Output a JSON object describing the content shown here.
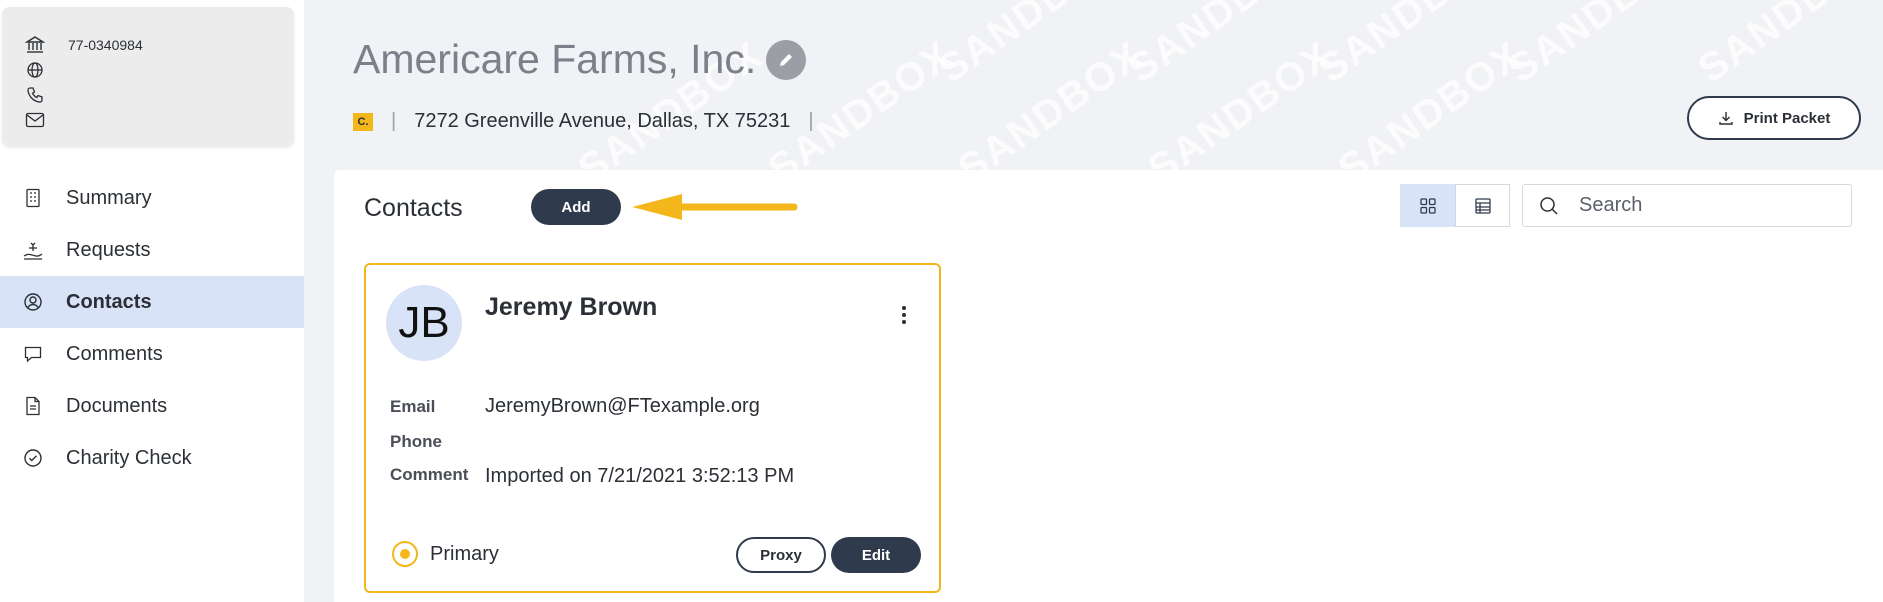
{
  "org": {
    "ein": "77-0340984",
    "name": "Americare Farms, Inc.",
    "badge": "C.",
    "address": "7272 Greenville Avenue, Dallas, TX 75231",
    "separator": "|"
  },
  "sidebar": {
    "items": [
      {
        "label": "Summary",
        "icon": "building-icon"
      },
      {
        "label": "Requests",
        "icon": "hand-gift-icon"
      },
      {
        "label": "Contacts",
        "icon": "user-circle-icon",
        "active": true
      },
      {
        "label": "Comments",
        "icon": "chat-bubble-icon"
      },
      {
        "label": "Documents",
        "icon": "document-icon"
      },
      {
        "label": "Charity Check",
        "icon": "check-circle-icon"
      }
    ]
  },
  "header": {
    "print_label": "Print Packet",
    "watermark": "SANDBOX"
  },
  "contacts": {
    "title": "Contacts",
    "add_label": "Add",
    "search_placeholder": "Search",
    "view_mode": "grid",
    "cards": [
      {
        "initials": "JB",
        "name": "Jeremy Brown",
        "email_label": "Email",
        "email": "JeremyBrown@FTexample.org",
        "phone_label": "Phone",
        "phone": "",
        "comment_label": "Comment",
        "comment": "Imported on 7/21/2021 3:52:13 PM",
        "primary_label": "Primary",
        "proxy_label": "Proxy",
        "edit_label": "Edit"
      }
    ]
  },
  "colors": {
    "accent": "#f3b71b",
    "dark_button": "#2f3b4c",
    "active_nav": "#d8e3f7"
  }
}
